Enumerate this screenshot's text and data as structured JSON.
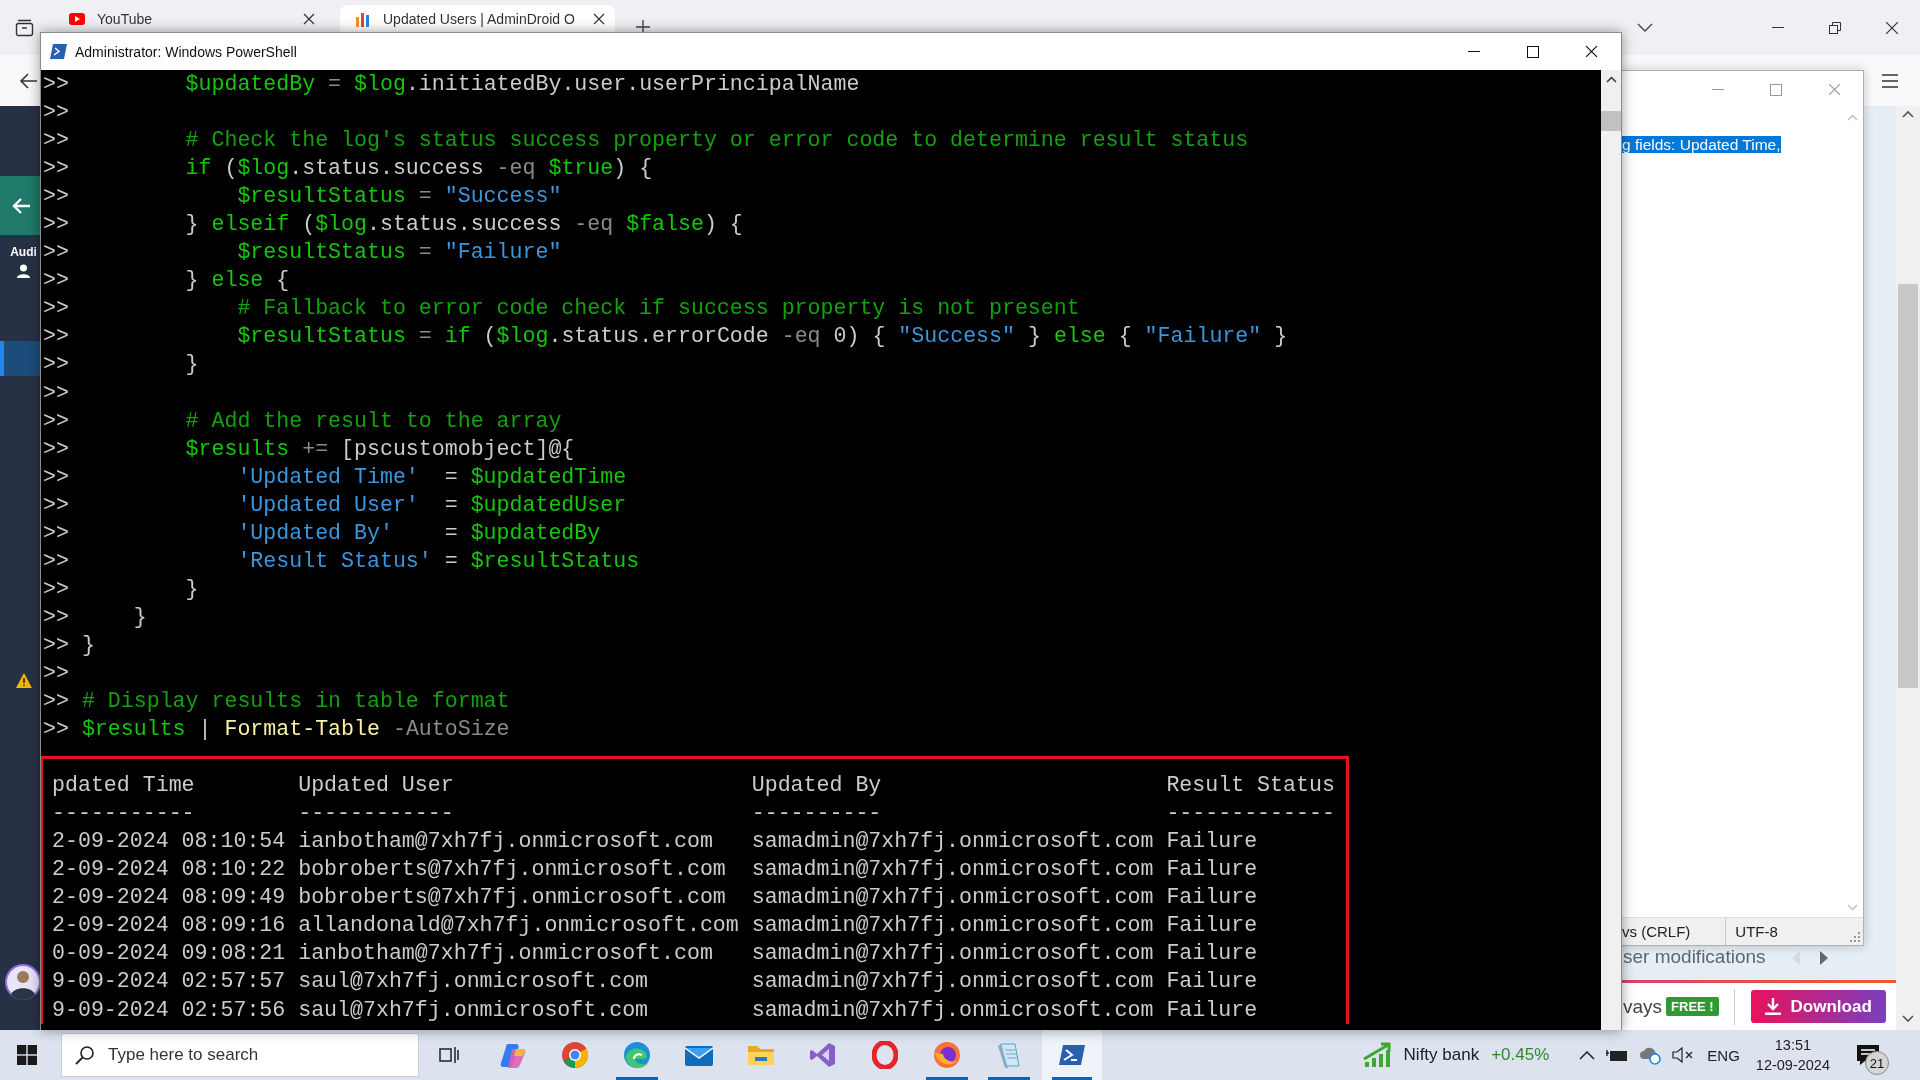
{
  "browser": {
    "tabs": [
      {
        "title": "YouTube",
        "selected": false
      },
      {
        "title": "Updated Users | AdminDroid O",
        "selected": true
      }
    ],
    "sidebar": {
      "items": [
        {
          "label": "Audi",
          "selected": false
        },
        {
          "selected": true
        }
      ]
    },
    "banner": {
      "text": "ser modifications"
    },
    "footer": {
      "text": "vays",
      "badge": "FREE !",
      "button": "Download"
    }
  },
  "notepad": {
    "selection": "g fields: Updated Time,",
    "line_ending": "vs (CRLF)",
    "encoding": "UTF-8"
  },
  "powershell": {
    "title": "Administrator: Windows PowerShell",
    "lines": [
      {
        "prompt": ">>",
        "tokens": [
          {
            "text": "         $updatedBy",
            "kind": "variable"
          },
          {
            "text": " = ",
            "kind": "operator"
          },
          {
            "text": "$log",
            "kind": "variable"
          },
          {
            "text": ".initiatedBy.user.userPrincipalName",
            "kind": "text"
          }
        ]
      },
      {
        "prompt": ">>"
      },
      {
        "prompt": ">>",
        "tokens": [
          {
            "text": "         # Check the log's status success property or error code to determine result status",
            "kind": "comment"
          }
        ]
      },
      {
        "prompt": ">>",
        "tokens": [
          {
            "text": "         if",
            "kind": "keyword"
          },
          {
            "text": " (",
            "kind": "text"
          },
          {
            "text": "$log",
            "kind": "variable"
          },
          {
            "text": ".status.success ",
            "kind": "text"
          },
          {
            "text": "-eq ",
            "kind": "operator"
          },
          {
            "text": "$true",
            "kind": "variable"
          },
          {
            "text": ") {",
            "kind": "text"
          }
        ]
      },
      {
        "prompt": ">>",
        "tokens": [
          {
            "text": "             $resultStatus",
            "kind": "variable"
          },
          {
            "text": " = ",
            "kind": "operator"
          },
          {
            "text": "\"Success\"",
            "kind": "string"
          }
        ]
      },
      {
        "prompt": ">>",
        "tokens": [
          {
            "text": "         } ",
            "kind": "text"
          },
          {
            "text": "elseif",
            "kind": "keyword"
          },
          {
            "text": " (",
            "kind": "text"
          },
          {
            "text": "$log",
            "kind": "variable"
          },
          {
            "text": ".status.success ",
            "kind": "text"
          },
          {
            "text": "-eq ",
            "kind": "operator"
          },
          {
            "text": "$false",
            "kind": "variable"
          },
          {
            "text": ") {",
            "kind": "text"
          }
        ]
      },
      {
        "prompt": ">>",
        "tokens": [
          {
            "text": "             $resultStatus",
            "kind": "variable"
          },
          {
            "text": " = ",
            "kind": "operator"
          },
          {
            "text": "\"Failure\"",
            "kind": "string"
          }
        ]
      },
      {
        "prompt": ">>",
        "tokens": [
          {
            "text": "         } ",
            "kind": "text"
          },
          {
            "text": "else",
            "kind": "keyword"
          },
          {
            "text": " {",
            "kind": "text"
          }
        ]
      },
      {
        "prompt": ">>",
        "tokens": [
          {
            "text": "             # Fallback to error code check if success property is not present",
            "kind": "comment"
          }
        ]
      },
      {
        "prompt": ">>",
        "tokens": [
          {
            "text": "             $resultStatus",
            "kind": "variable"
          },
          {
            "text": " = ",
            "kind": "operator"
          },
          {
            "text": "if",
            "kind": "keyword"
          },
          {
            "text": " (",
            "kind": "text"
          },
          {
            "text": "$log",
            "kind": "variable"
          },
          {
            "text": ".status.errorCode ",
            "kind": "text"
          },
          {
            "text": "-eq",
            "kind": "operator"
          },
          {
            "text": " 0) { ",
            "kind": "text"
          },
          {
            "text": "\"Success\"",
            "kind": "string"
          },
          {
            "text": " } ",
            "kind": "text"
          },
          {
            "text": "else",
            "kind": "keyword"
          },
          {
            "text": " { ",
            "kind": "text"
          },
          {
            "text": "\"Failure\"",
            "kind": "string"
          },
          {
            "text": " }",
            "kind": "text"
          }
        ]
      },
      {
        "prompt": ">>",
        "tokens": [
          {
            "text": "         }",
            "kind": "text"
          }
        ]
      },
      {
        "prompt": ">>"
      },
      {
        "prompt": ">>",
        "tokens": [
          {
            "text": "         # Add the result to the array",
            "kind": "comment"
          }
        ]
      },
      {
        "prompt": ">>",
        "tokens": [
          {
            "text": "         $results",
            "kind": "variable"
          },
          {
            "text": " += ",
            "kind": "operator"
          },
          {
            "text": "[pscustomobject]",
            "kind": "type"
          },
          {
            "text": "@{",
            "kind": "text"
          }
        ]
      },
      {
        "prompt": ">>",
        "tokens": [
          {
            "text": "             'Updated Time'",
            "kind": "string"
          },
          {
            "text": "  = ",
            "kind": "text"
          },
          {
            "text": "$updatedTime",
            "kind": "variable"
          }
        ]
      },
      {
        "prompt": ">>",
        "tokens": [
          {
            "text": "             'Updated User'",
            "kind": "string"
          },
          {
            "text": "  = ",
            "kind": "text"
          },
          {
            "text": "$updatedUser",
            "kind": "variable"
          }
        ]
      },
      {
        "prompt": ">>",
        "tokens": [
          {
            "text": "             'Updated By'",
            "kind": "string"
          },
          {
            "text": "    = ",
            "kind": "text"
          },
          {
            "text": "$updatedBy",
            "kind": "variable"
          }
        ]
      },
      {
        "prompt": ">>",
        "tokens": [
          {
            "text": "             'Result Status'",
            "kind": "string"
          },
          {
            "text": " = ",
            "kind": "text"
          },
          {
            "text": "$resultStatus",
            "kind": "variable"
          }
        ]
      },
      {
        "prompt": ">>",
        "tokens": [
          {
            "text": "         }",
            "kind": "text"
          }
        ]
      },
      {
        "prompt": ">>",
        "tokens": [
          {
            "text": "     }",
            "kind": "text"
          }
        ]
      },
      {
        "prompt": ">>",
        "tokens": [
          {
            "text": " }",
            "kind": "text"
          }
        ]
      },
      {
        "prompt": ">>"
      },
      {
        "prompt": ">>",
        "tokens": [
          {
            "text": " # Display results in table format",
            "kind": "comment"
          }
        ]
      },
      {
        "prompt": ">>",
        "tokens": [
          {
            "text": " $results",
            "kind": "variable"
          },
          {
            "text": " | ",
            "kind": "text"
          },
          {
            "text": "Format-Table",
            "kind": "command"
          },
          {
            "text": " -AutoSize",
            "kind": "parameter"
          }
        ]
      }
    ],
    "table": {
      "columns": [
        {
          "header": "pdated Time",
          "underline": "-----------"
        },
        {
          "header": "Updated User",
          "underline": "------------"
        },
        {
          "header": "Updated By",
          "underline": "----------"
        },
        {
          "header": "Result Status",
          "underline": "-------------"
        }
      ],
      "rows": [
        [
          "2-09-2024 08:10:54",
          "ianbotham@7xh7fj.onmicrosoft.com",
          "samadmin@7xh7fj.onmicrosoft.com",
          "Failure"
        ],
        [
          "2-09-2024 08:10:22",
          "bobroberts@7xh7fj.onmicrosoft.com",
          "samadmin@7xh7fj.onmicrosoft.com",
          "Failure"
        ],
        [
          "2-09-2024 08:09:49",
          "bobroberts@7xh7fj.onmicrosoft.com",
          "samadmin@7xh7fj.onmicrosoft.com",
          "Failure"
        ],
        [
          "2-09-2024 08:09:16",
          "allandonald@7xh7fj.onmicrosoft.com",
          "samadmin@7xh7fj.onmicrosoft.com",
          "Failure"
        ],
        [
          "0-09-2024 09:08:21",
          "ianbotham@7xh7fj.onmicrosoft.com",
          "samadmin@7xh7fj.onmicrosoft.com",
          "Failure"
        ],
        [
          "9-09-2024 02:57:57",
          "saul@7xh7fj.onmicrosoft.com",
          "samadmin@7xh7fj.onmicrosoft.com",
          "Failure"
        ],
        [
          "9-09-2024 02:57:56",
          "saul@7xh7fj.onmicrosoft.com",
          "samadmin@7xh7fj.onmicrosoft.com",
          "Failure"
        ]
      ]
    }
  },
  "taskbar": {
    "search": {
      "placeholder": "Type here to search"
    },
    "apps": [
      {
        "kind": "sparkle",
        "running": false,
        "selected": false
      },
      {
        "kind": "chrome",
        "running": false,
        "selected": false
      },
      {
        "kind": "wave",
        "running": true,
        "selected": false
      },
      {
        "kind": "mail",
        "running": false,
        "selected": false
      },
      {
        "kind": "folder",
        "running": false,
        "selected": false
      },
      {
        "kind": "ribbon",
        "running": false,
        "selected": false
      },
      {
        "kind": "ring",
        "running": false,
        "selected": false
      },
      {
        "kind": "fox",
        "running": true,
        "selected": false
      },
      {
        "kind": "notepad",
        "running": true,
        "selected": false
      },
      {
        "kind": "terminal",
        "running": true,
        "selected": true
      }
    ],
    "widget": {
      "name": "Nifty bank",
      "change": "+0.45%"
    },
    "language": "ENG",
    "time": "13:51",
    "date": "12-09-2024",
    "notifications": "21"
  }
}
